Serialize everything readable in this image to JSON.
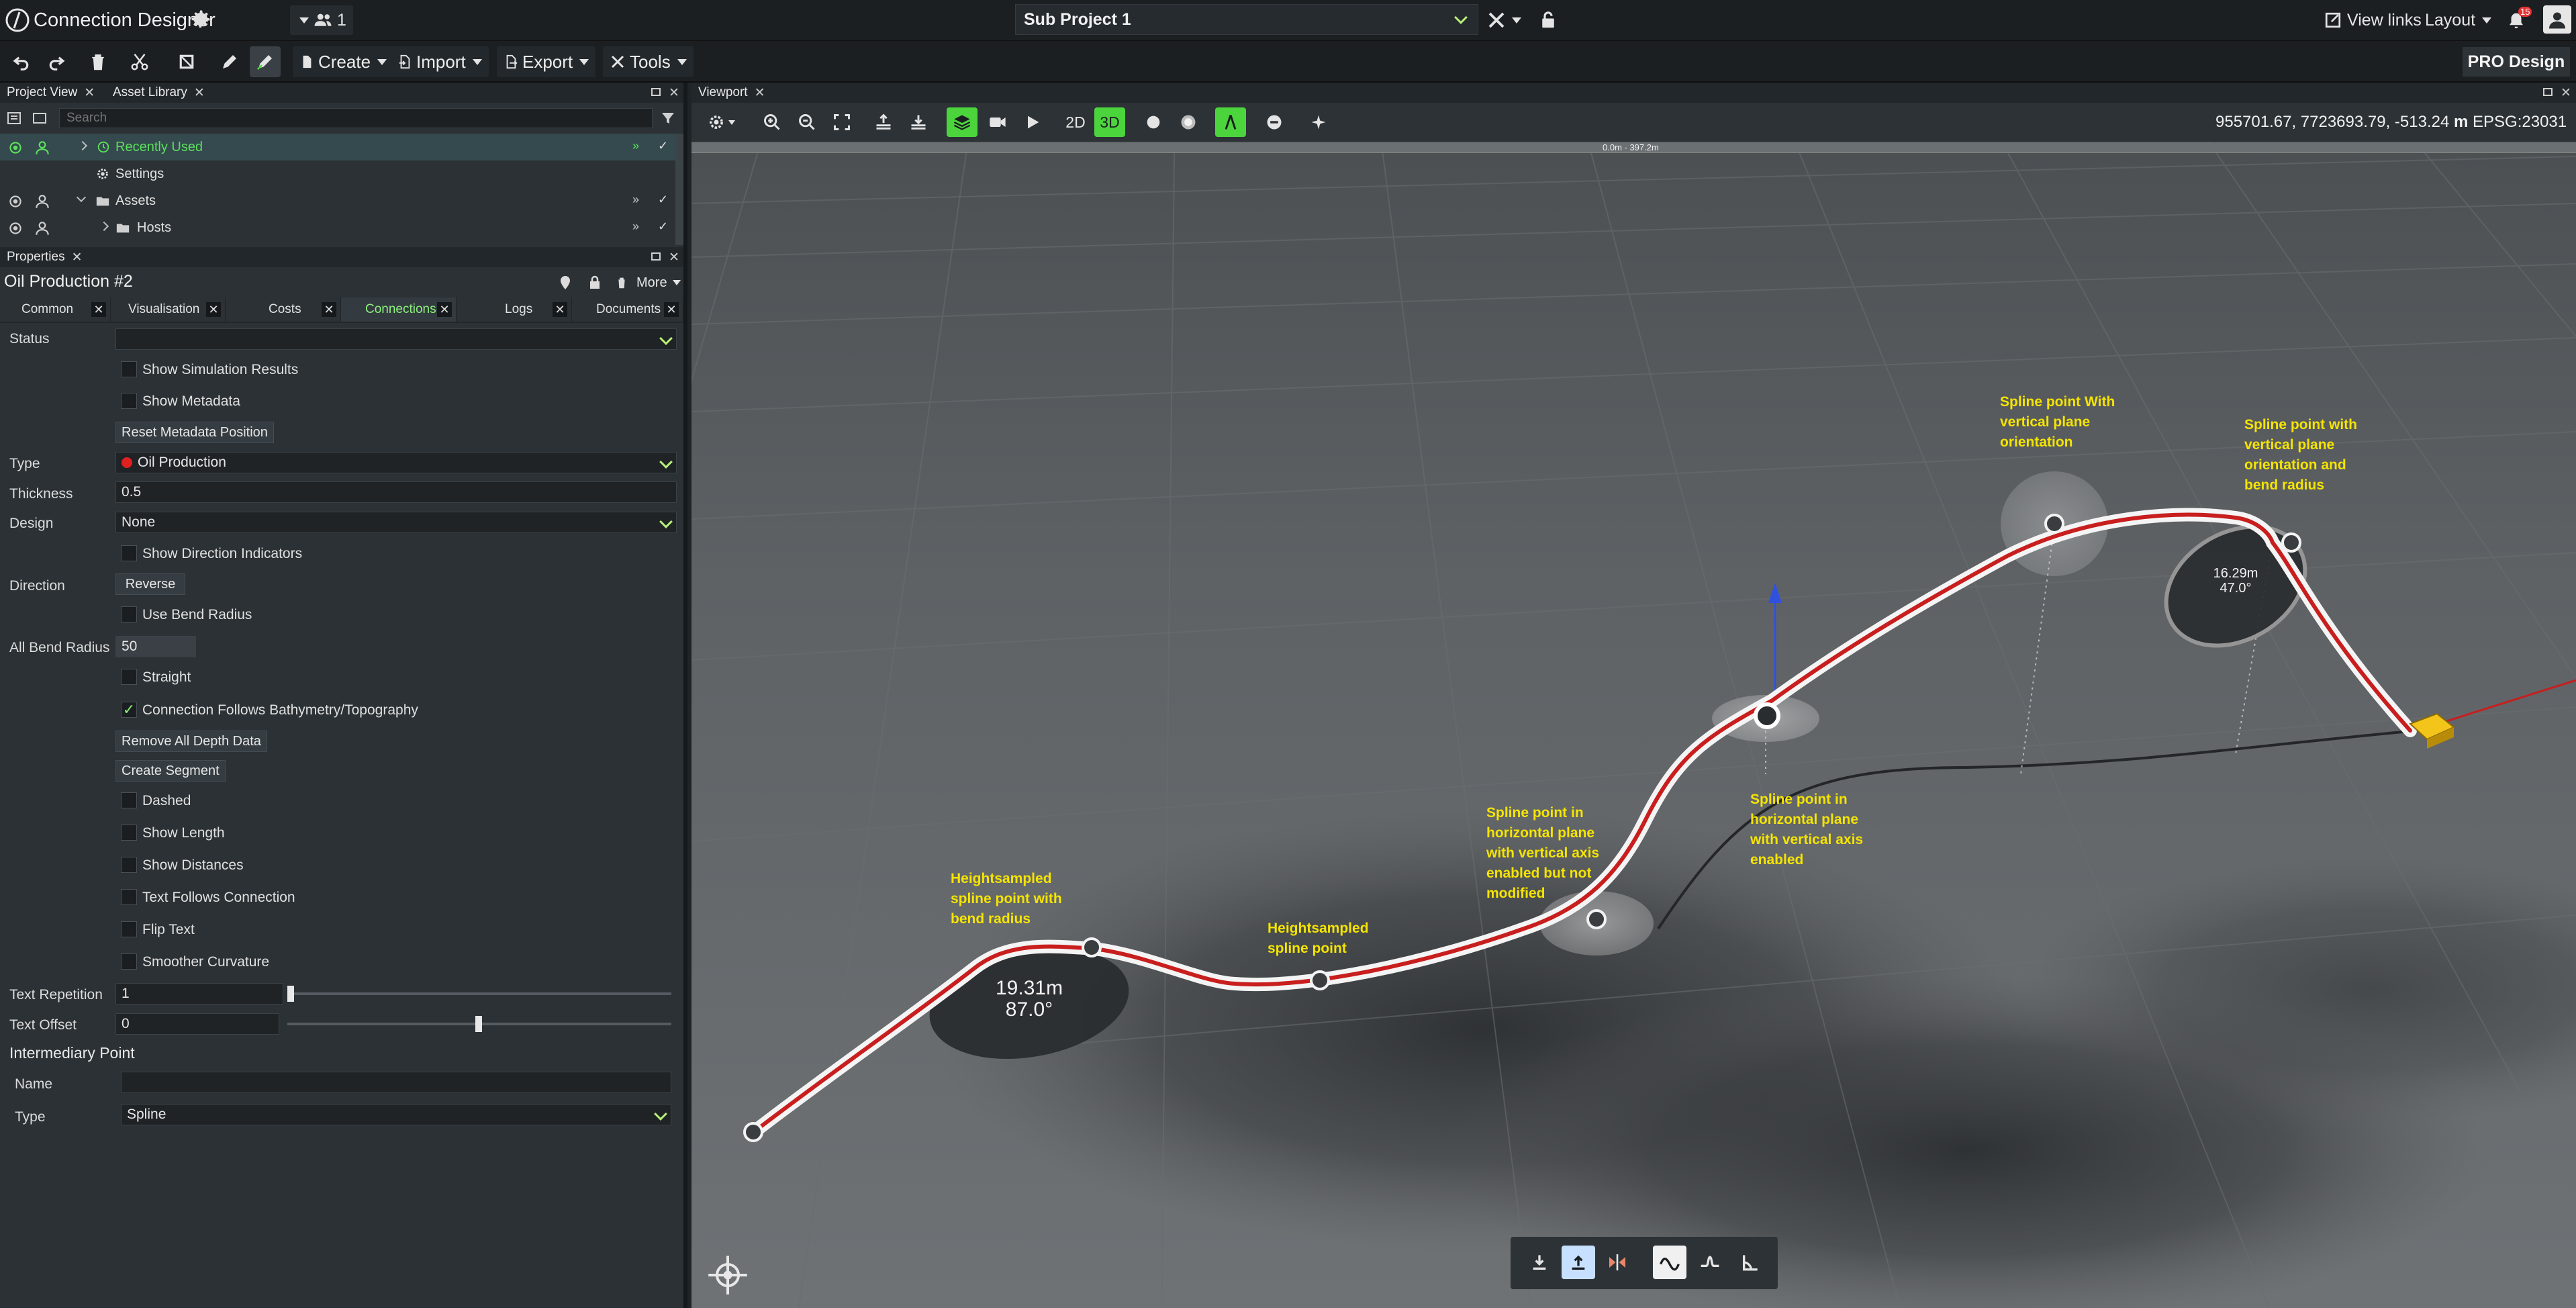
{
  "app": {
    "title": "Connection Designer",
    "user_count": "1",
    "project": "Sub Project 1",
    "view_links": "View links",
    "layout": "Layout",
    "notification_count": "15",
    "edition": "PRO Design"
  },
  "toolbar": {
    "create": "Create",
    "import": "Import",
    "export": "Export",
    "tools": "Tools"
  },
  "project_panel": {
    "tab_project_view": "Project View",
    "tab_asset_library": "Asset Library",
    "search_placeholder": "Search",
    "items": [
      {
        "label": "Recently Used"
      },
      {
        "label": "Settings"
      },
      {
        "label": "Assets"
      },
      {
        "label": "Hosts"
      }
    ]
  },
  "properties": {
    "panel_title": "Properties",
    "object_name": "Oil Production #2",
    "more": "More",
    "tabs": [
      "Common",
      "Visualisation",
      "Costs",
      "Connections",
      "Logs",
      "Documents"
    ],
    "active_tab": "Connections",
    "status_label": "Status",
    "status_value": "",
    "show_simulation_results": "Show Simulation Results",
    "show_metadata": "Show Metadata",
    "reset_metadata_position": "Reset Metadata Position",
    "type_label": "Type",
    "type_value": "Oil Production",
    "type_color": "#e02020",
    "thickness_label": "Thickness",
    "thickness_value": "0.5",
    "design_label": "Design",
    "design_value": "None",
    "show_direction_indicators": "Show Direction Indicators",
    "direction_label": "Direction",
    "reverse": "Reverse",
    "use_bend_radius": "Use Bend Radius",
    "all_bend_radius_label": "All Bend Radius",
    "all_bend_radius_value": "50",
    "straight": "Straight",
    "follows_bathymetry": "Connection Follows Bathymetry/Topography",
    "follows_bathymetry_checked": true,
    "remove_depth_data": "Remove All Depth Data",
    "create_segment": "Create Segment",
    "dashed": "Dashed",
    "show_length": "Show Length",
    "show_distances": "Show Distances",
    "text_follows_connection": "Text Follows Connection",
    "flip_text": "Flip Text",
    "smoother_curvature": "Smoother Curvature",
    "text_repetition_label": "Text Repetition",
    "text_repetition_value": "1",
    "text_offset_label": "Text Offset",
    "text_offset_value": "0",
    "intermediary_point_heading": "Intermediary Point",
    "name_label": "Name",
    "name_value": "",
    "ip_type_label": "Type",
    "ip_type_value": "Spline"
  },
  "viewport": {
    "tab": "Viewport",
    "mode_2d": "2D",
    "mode_3d": "3D",
    "active_mode": "3D",
    "coordinates": "955701.67, 7723693.79, -513.24",
    "coord_unit": "m",
    "crs": "EPSG:23031",
    "scale_label": "0.0m - 397.2m",
    "bend1_length": "19.31m",
    "bend1_angle": "87.0°",
    "bend2_length": "16.29m",
    "bend2_angle": "47.0°",
    "annotations": [
      "Heightsampled\nspline point with\nbend radius",
      "Heightsampled\nspline point",
      "Spline point in\nhorizontal plane\nwith vertical axis\nenabled but not\nmodified",
      "Spline point in\nhorizontal plane\nwith vertical axis\nenabled",
      "Spline point With\nvertical plane\norientation",
      "Spline point with\nvertical plane\norientation and\nbend radius"
    ]
  },
  "colors": {
    "accent_green": "#4cd43c",
    "annotation_yellow": "#f5e400",
    "pipe_red": "#c81e1e"
  }
}
